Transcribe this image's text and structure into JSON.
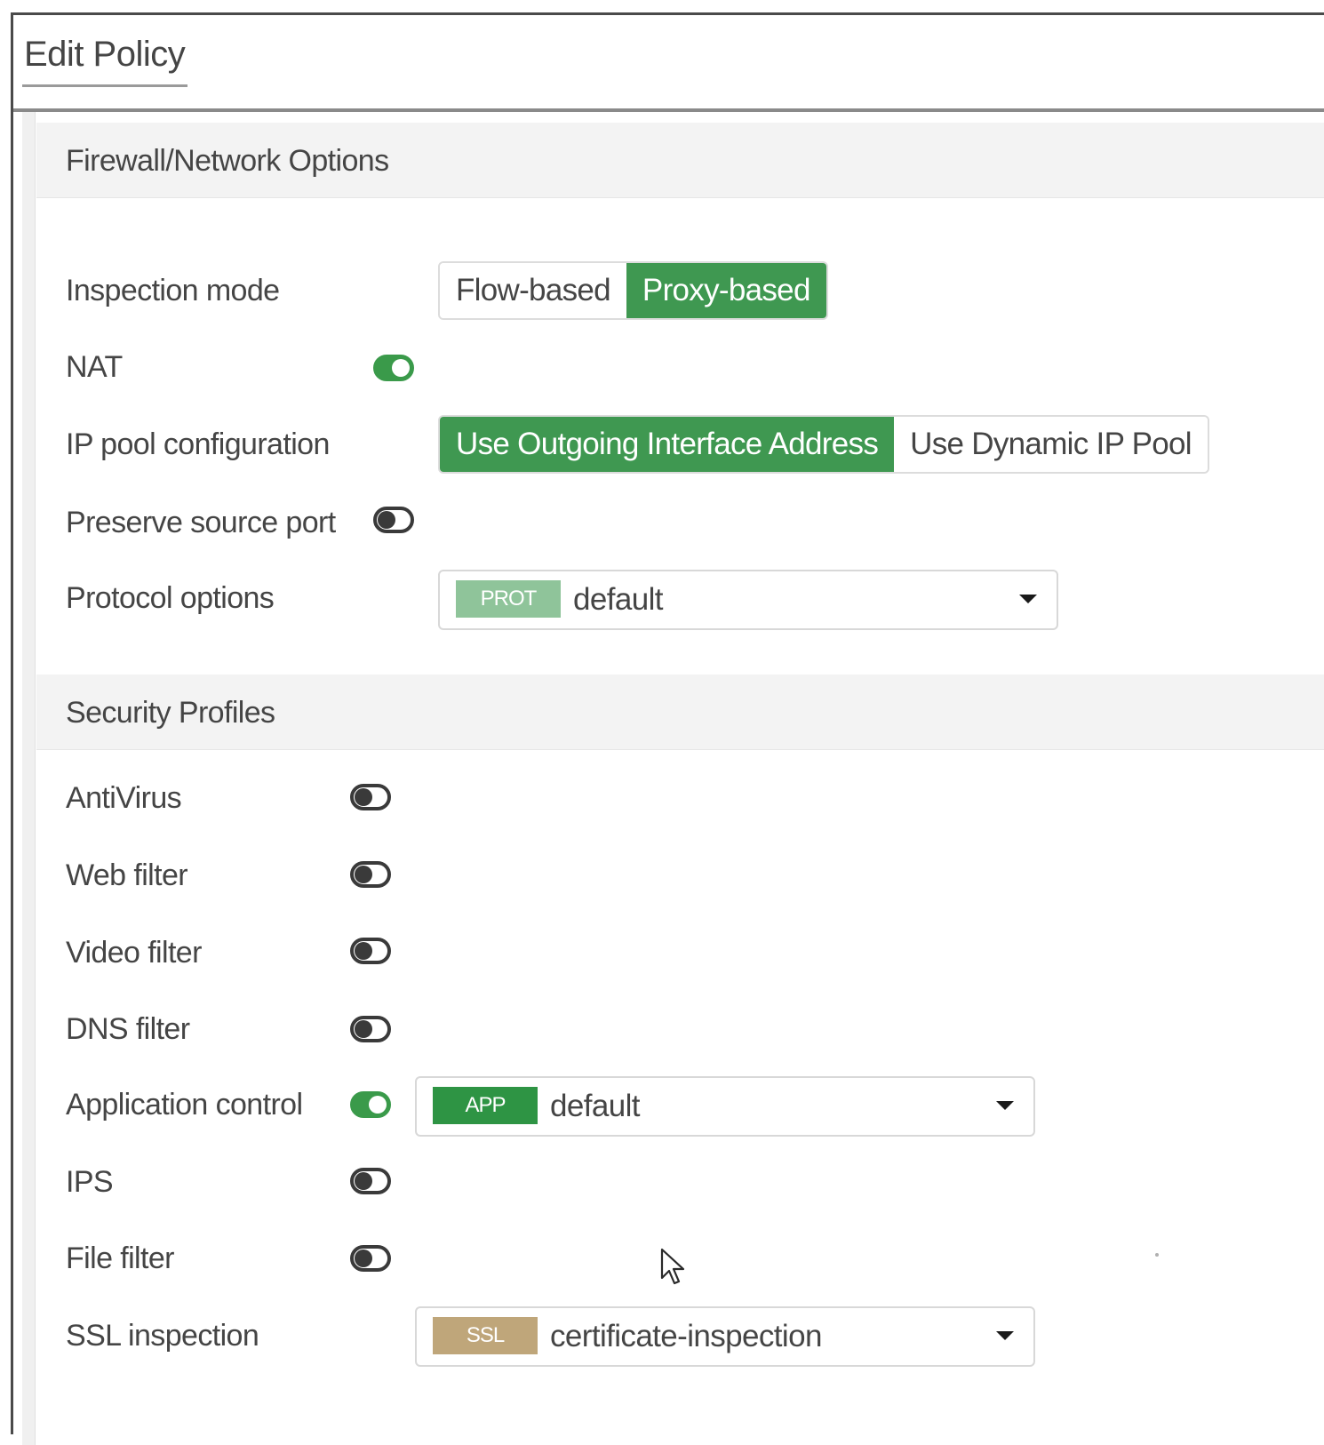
{
  "dialog": {
    "title": "Edit Policy"
  },
  "firewall_section": {
    "title": "Firewall/Network Options",
    "inspection_mode": {
      "label": "Inspection mode",
      "options": [
        "Flow-based",
        "Proxy-based"
      ],
      "selected": "Proxy-based"
    },
    "nat": {
      "label": "NAT",
      "enabled": true
    },
    "ip_pool": {
      "label": "IP pool configuration",
      "options": [
        "Use Outgoing Interface Address",
        "Use Dynamic IP Pool"
      ],
      "selected": "Use Outgoing Interface Address"
    },
    "preserve_source_port": {
      "label": "Preserve source port",
      "enabled": false
    },
    "protocol_options": {
      "label": "Protocol options",
      "tag": "PROT",
      "tag_color": "#8fc49a",
      "value": "default"
    }
  },
  "security_section": {
    "title": "Security Profiles",
    "antivirus": {
      "label": "AntiVirus",
      "enabled": false
    },
    "web_filter": {
      "label": "Web filter",
      "enabled": false
    },
    "video_filter": {
      "label": "Video filter",
      "enabled": false
    },
    "dns_filter": {
      "label": "DNS filter",
      "enabled": false
    },
    "application_control": {
      "label": "Application control",
      "enabled": true,
      "tag": "APP",
      "tag_color": "#2e9444",
      "value": "default"
    },
    "ips": {
      "label": "IPS",
      "enabled": false
    },
    "file_filter": {
      "label": "File filter",
      "enabled": false
    },
    "ssl_inspection": {
      "label": "SSL inspection",
      "tag": "SSL",
      "tag_color": "#bfa67a",
      "value": "certificate-inspection"
    }
  },
  "colors": {
    "accent_green": "#3f9851",
    "toggle_off": "#3a3a3a"
  },
  "icons": {
    "dropdown": "caret-down-icon",
    "cursor": "mouse-pointer-icon"
  }
}
